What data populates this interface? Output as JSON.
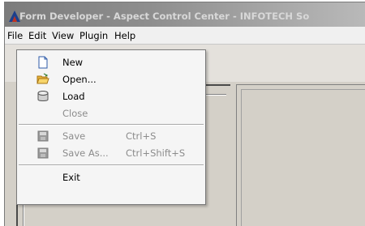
{
  "window": {
    "title": "Form Developer - Aspect Control Center - INFOTECH So"
  },
  "menubar": {
    "items": [
      "File",
      "Edit",
      "View",
      "Plugin",
      "Help"
    ]
  },
  "file_menu": {
    "items": [
      {
        "label": "New",
        "icon": "new-document-icon",
        "enabled": true
      },
      {
        "label": "Open...",
        "icon": "open-folder-icon",
        "enabled": true
      },
      {
        "label": "Load",
        "icon": "database-icon",
        "enabled": true
      },
      {
        "label": "Close",
        "enabled": false
      },
      {
        "label": "Save",
        "shortcut": "Ctrl+S",
        "icon": "save-icon",
        "enabled": false
      },
      {
        "label": "Save As...",
        "shortcut": "Ctrl+Shift+S",
        "icon": "save-as-icon",
        "enabled": false
      },
      {
        "label": "Exit",
        "enabled": true
      }
    ]
  }
}
